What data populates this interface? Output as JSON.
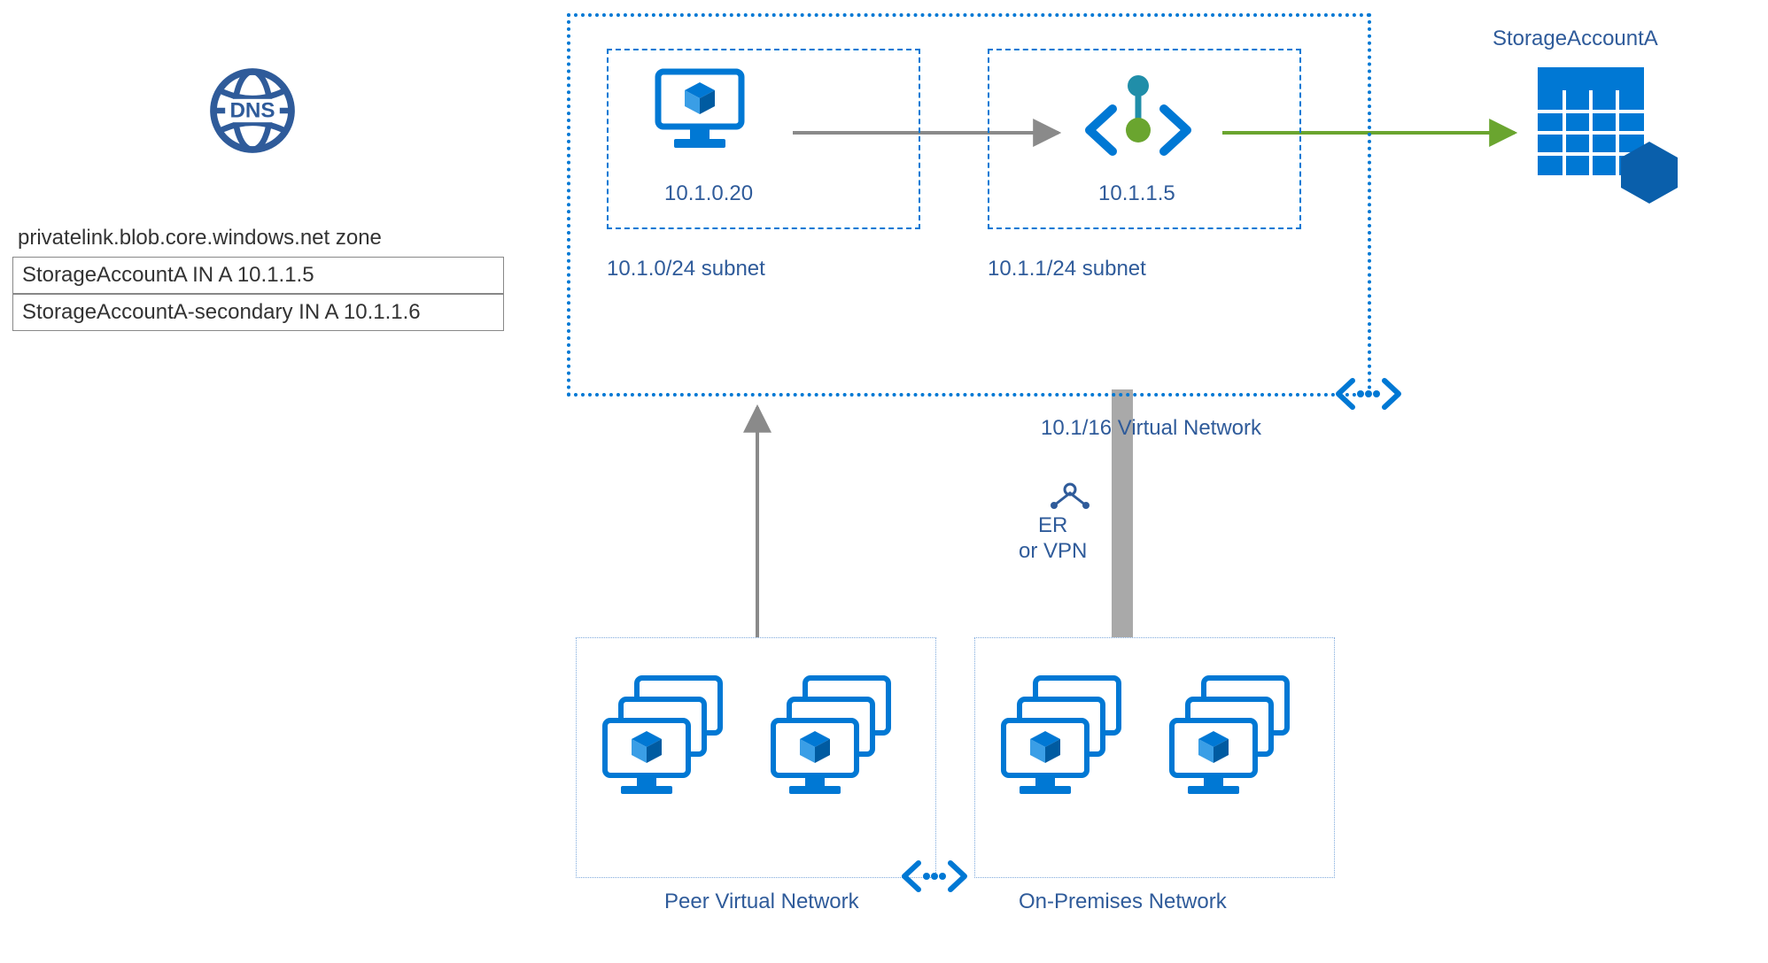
{
  "dns": {
    "zone_label": "privatelink.blob.core.windows.net zone",
    "records": [
      "StorageAccountA IN A 10.1.1.5",
      "StorageAccountA-secondary IN A 10.1.1.6"
    ]
  },
  "vnet": {
    "label": "10.1/16 Virtual Network",
    "subnets": [
      {
        "cidr": "10.1.0/24 subnet",
        "host_ip": "10.1.0.20"
      },
      {
        "cidr": "10.1.1/24 subnet",
        "endpoint_ip": "10.1.1.5"
      }
    ]
  },
  "storage": {
    "name": "StorageAccountA"
  },
  "connection": {
    "type_label": "ER\nor VPN"
  },
  "peer_network": {
    "label": "Peer Virtual Network"
  },
  "onprem_network": {
    "label": "On-Premises Network"
  },
  "icons": {
    "dns": "dns-icon",
    "vm": "vm-icon",
    "private_endpoint": "private-endpoint-icon",
    "vnet": "vnet-icon",
    "vnet_peer": "vnet-peer-icon",
    "vm_group": "vm-group-icon",
    "storage": "storage-account-icon",
    "gateway": "gateway-icon"
  },
  "colors": {
    "azure_blue": "#0078d4",
    "text_blue": "#2f5b9a",
    "green": "#6aa52f",
    "teal": "#208ea9",
    "gray": "#8a8a8a"
  }
}
